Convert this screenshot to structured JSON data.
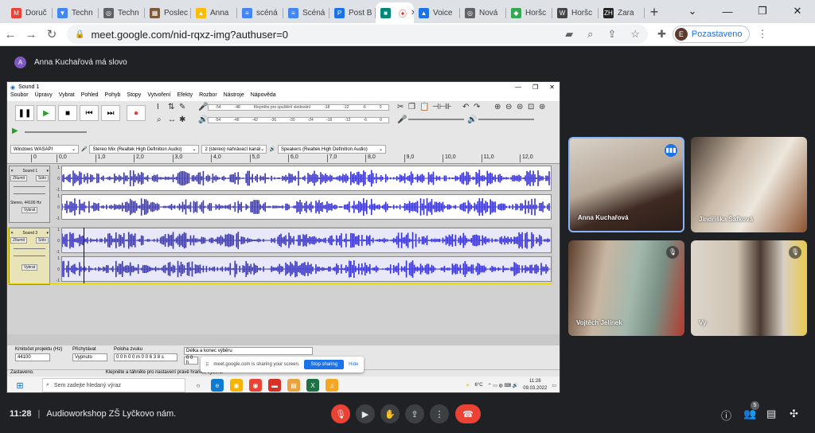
{
  "browser": {
    "tabs": [
      {
        "label": "Doruč",
        "fav_color": "#ea4335",
        "fav_glyph": "M"
      },
      {
        "label": "Techn",
        "fav_color": "#4285f4",
        "fav_glyph": "▼"
      },
      {
        "label": "Techn",
        "fav_color": "#5f6368",
        "fav_glyph": "◎"
      },
      {
        "label": "Poslec",
        "fav_color": "#7b5a3c",
        "fav_glyph": "▦"
      },
      {
        "label": "Anna",
        "fav_color": "#fbbc04",
        "fav_glyph": "▲"
      },
      {
        "label": "scéná",
        "fav_color": "#4285f4",
        "fav_glyph": "≡"
      },
      {
        "label": "Scéná",
        "fav_color": "#4285f4",
        "fav_glyph": "≡"
      },
      {
        "label": "Post B",
        "fav_color": "#1a73e8",
        "fav_glyph": "P"
      },
      {
        "label": "",
        "fav_color": "#00897b",
        "fav_glyph": "■",
        "active": true
      },
      {
        "label": "Voice",
        "fav_color": "#1a73e8",
        "fav_glyph": "▲"
      },
      {
        "label": "Nová",
        "fav_color": "#5f6368",
        "fav_glyph": "◎"
      },
      {
        "label": "Horšc",
        "fav_color": "#34a853",
        "fav_glyph": "◆"
      },
      {
        "label": "Horšc",
        "fav_color": "#444",
        "fav_glyph": "W"
      },
      {
        "label": "Zara",
        "fav_color": "#222",
        "fav_glyph": "ZH"
      }
    ],
    "new_tab": "+",
    "window_controls": [
      "⌄",
      "—",
      "❐",
      "✕"
    ],
    "url": "meet.google.com/nid-rqxz-img?authuser=0",
    "profile_initial": "E",
    "profile_label": "Pozastaveno"
  },
  "meet": {
    "presenter_initial": "A",
    "presenter_text": "Anna Kuchařová má slovo",
    "time": "11:28",
    "separator": "|",
    "meeting_name": "Audioworkshop ZŠ Lyčkovo nám.",
    "participant_count": "5",
    "participants": [
      {
        "name": "Anna Kuchařová",
        "speaking": true
      },
      {
        "name": "Jindřiška Šafková",
        "muted": false
      },
      {
        "name": "Vojtěch Jelínek",
        "muted": true
      },
      {
        "name": "Vy",
        "muted": true
      }
    ]
  },
  "audacity": {
    "title": "Sound 1",
    "menu": [
      "Soubor",
      "Úpravy",
      "Vybrat",
      "Pohled",
      "Pohyb",
      "Stopy",
      "Vytvoření",
      "Efekty",
      "Rozbor",
      "Nástroje",
      "Nápověda"
    ],
    "meter_prompt": "Klepněte pro spuštění sledování",
    "meter_ticks": [
      "-54",
      "-48",
      "-42",
      "-36",
      "-30",
      "-24",
      "-18",
      "-12",
      "-6",
      "0"
    ],
    "host": "Windows WASAPI",
    "input_device": "Stereo Mix (Realtek High Definition Audio)",
    "channels": "2 (stereo) nahrávací kanál",
    "output_device": "Speakers (Realtek High Definition Audio)",
    "ruler": [
      "0",
      "0,0",
      "1,0",
      "2,0",
      "3,0",
      "4,0",
      "5,0",
      "6,0",
      "7,0",
      "8,0",
      "9,0",
      "10,0",
      "11,0",
      "12,0"
    ],
    "tracks": [
      {
        "name": "Sound 1",
        "mute": "Ztlumit",
        "solo": "Sólo",
        "info": "Stereo, 44100 Hz",
        "select": "Vybrat"
      },
      {
        "name": "Sound 3",
        "mute": "Ztlumit",
        "solo": "Sólo",
        "info": "",
        "select": "Vybrat"
      }
    ],
    "scale": [
      "1",
      "0",
      "-1"
    ],
    "rate_label": "Kmitočet projektu (Hz)",
    "rate_value": "44100",
    "snap_label": "Přichytávat",
    "snap_value": "Vypnuto",
    "pos_label": "Poloha zvuku",
    "pos_value": "0 0 h 0 0 m 0 0 6 3 8 s",
    "sel_label": "Délka a konec výběru",
    "sel_value": "0 0 h",
    "status_left": "Zastaveno.",
    "status_hint": "Klepněte a táhněte pro nastavení pravé hranice výběru.",
    "share_notice": "meet.google.com is sharing your screen.",
    "share_stop": "Stop sharing",
    "share_hide": "Hide"
  },
  "taskbar": {
    "search_placeholder": "Sem zadejte hledaný výraz",
    "weather": "6°C",
    "time": "11:28",
    "date": "09.03.2022"
  }
}
